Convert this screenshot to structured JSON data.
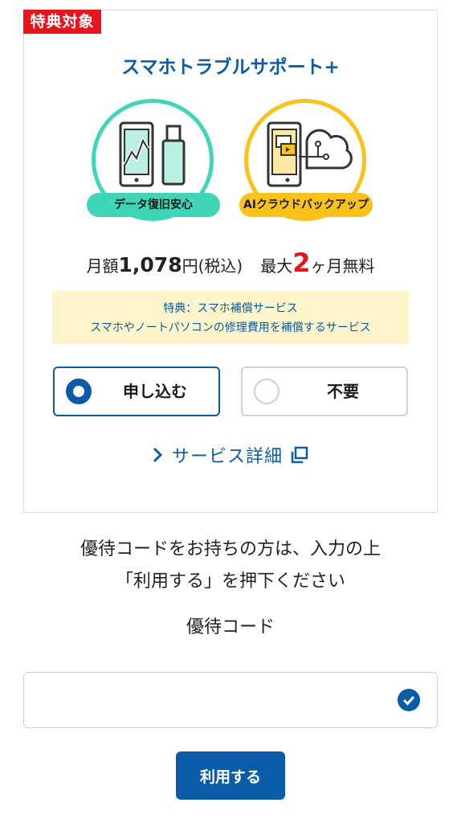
{
  "badge": "特典対象",
  "service": {
    "title": "スマホトラブルサポート+",
    "features": [
      {
        "label": "データ復旧安心",
        "icon": "smartphone-usb-icon"
      },
      {
        "label": "AIクラウドバックアップ",
        "icon": "cloud-backup-icon"
      }
    ],
    "price": {
      "prefix": "月額",
      "amount": "1,078",
      "unit": "円",
      "tax": "(税込)",
      "free_prefix": "最大",
      "free_number": "2",
      "free_suffix": "ヶ月無料"
    },
    "notice": {
      "line1": "特典：スマホ補償サービス",
      "line2": "スマホやノートパソコンの修理費用を補償するサービス"
    },
    "options": [
      {
        "label": "申し込む",
        "selected": true
      },
      {
        "label": "不要",
        "selected": false
      }
    ],
    "detail_link": "サービス詳細"
  },
  "coupon": {
    "guide_line1": "優待コードをお持ちの方は、入力の上",
    "guide_line2": "「利用する」を押下ください",
    "label": "優待コード",
    "value": "",
    "placeholder": "",
    "submit_label": "利用する"
  },
  "colors": {
    "primary": "#0b5ca8",
    "badge": "#e8141c",
    "teal": "#3ed6b6",
    "yellow": "#f9c21b",
    "notice_bg": "#fdf5c9"
  }
}
